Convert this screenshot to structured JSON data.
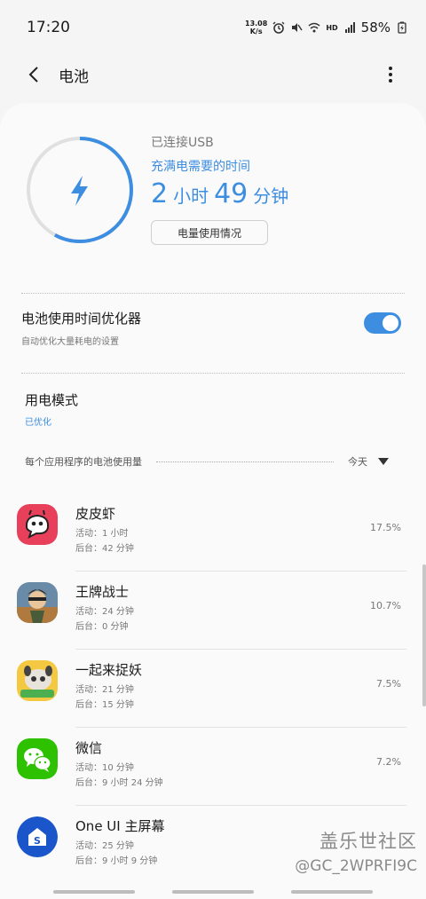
{
  "status_bar": {
    "time": "17:20",
    "net_speed_value": "13.08",
    "net_speed_unit": "K/s",
    "network": "HD",
    "signal": "4G",
    "battery": "58%"
  },
  "header": {
    "title": "电池"
  },
  "battery": {
    "connection": "已连接USB",
    "full_charge_label": "充满电需要的时间",
    "hours": "2",
    "hours_unit": "小时",
    "minutes": "49",
    "minutes_unit": "分钟",
    "usage_button": "电量使用情况",
    "charge_level_percent": 58
  },
  "optimizer": {
    "title": "电池使用时间优化器",
    "desc": "自动优化大量耗电的设置",
    "enabled": true
  },
  "power_mode": {
    "title": "用电模式",
    "value": "已优化"
  },
  "app_usage": {
    "title": "每个应用程序的电池使用量",
    "period": "今天",
    "apps": [
      {
        "name": "皮皮虾",
        "active": "活动：1 小时",
        "background": "后台：42 分钟",
        "percent": "17.5%",
        "icon": "pipixia-icon"
      },
      {
        "name": "王牌战士",
        "active": "活动：24 分钟",
        "background": "后台：0 分钟",
        "percent": "10.7%",
        "icon": "wangpai-icon"
      },
      {
        "name": "一起来捉妖",
        "active": "活动：21 分钟",
        "background": "后台：15 分钟",
        "percent": "7.5%",
        "icon": "zhuoyao-icon"
      },
      {
        "name": "微信",
        "active": "活动：10 分钟",
        "background": "后台：9 小时 24 分钟",
        "percent": "7.2%",
        "icon": "wechat-icon"
      },
      {
        "name": "One UI 主屏幕",
        "active": "活动：25 分钟",
        "background": "后台：9 小时 9 分钟",
        "percent": "",
        "icon": "oneui-home-icon"
      }
    ]
  },
  "watermark": {
    "line1": "盖乐世社区",
    "line2": "@GC_2WPRFI9C"
  },
  "colors": {
    "accent": "#3d8ee0",
    "pipixia": "#e8405a",
    "wechat": "#2dc100",
    "oneui": "#1a56c9"
  }
}
